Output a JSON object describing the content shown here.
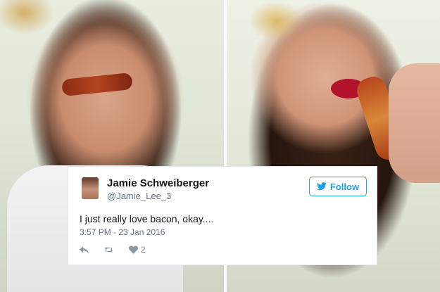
{
  "tweet": {
    "name": "Jamie Schweiberger",
    "handle": "@Jamie_Lee_3",
    "follow_label": "Follow",
    "text": "I just really love bacon, okay....",
    "timestamp": "3:57 PM - 23 Jan 2016",
    "like_count": "2",
    "icons": [
      "twitter-bird-icon",
      "reply-icon",
      "retweet-icon",
      "like-heart-icon"
    ],
    "colors": {
      "accent": "#1da1f2",
      "name": "#14171a",
      "muted": "#657786"
    }
  }
}
